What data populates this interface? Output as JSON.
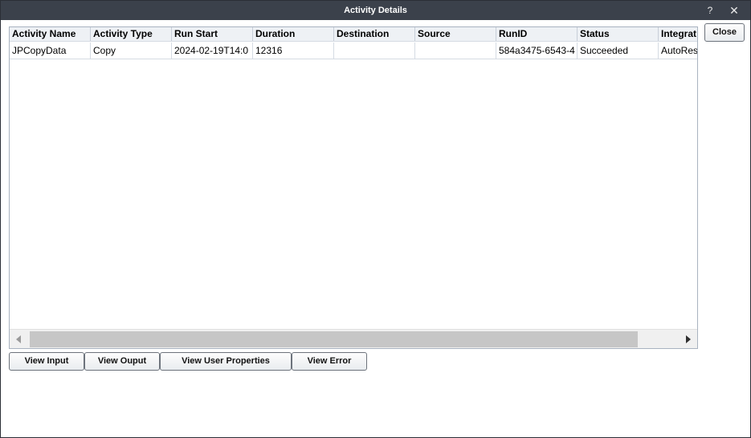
{
  "window": {
    "title": "Activity Details",
    "help_glyph": "?",
    "close_glyph": "✕"
  },
  "grid": {
    "columns": [
      "Activity Name",
      "Activity Type",
      "Run Start",
      "Duration",
      "Destination",
      "Source",
      "RunID",
      "Status",
      "Integrat"
    ],
    "rows": [
      [
        "JPCopyData",
        "Copy",
        "2024-02-19T14:0",
        "12316",
        "",
        "",
        "584a3475-6543-4",
        "Succeeded",
        "AutoRes"
      ]
    ]
  },
  "buttons": {
    "view_input": "View Input",
    "view_output": "View Ouput",
    "view_user_properties": "View User Properties",
    "view_error": "View Error",
    "close": "Close"
  },
  "icons": {
    "help": "help-icon",
    "close": "close-icon",
    "scroll_left": "chevron-left-icon",
    "scroll_right": "chevron-right-icon"
  }
}
